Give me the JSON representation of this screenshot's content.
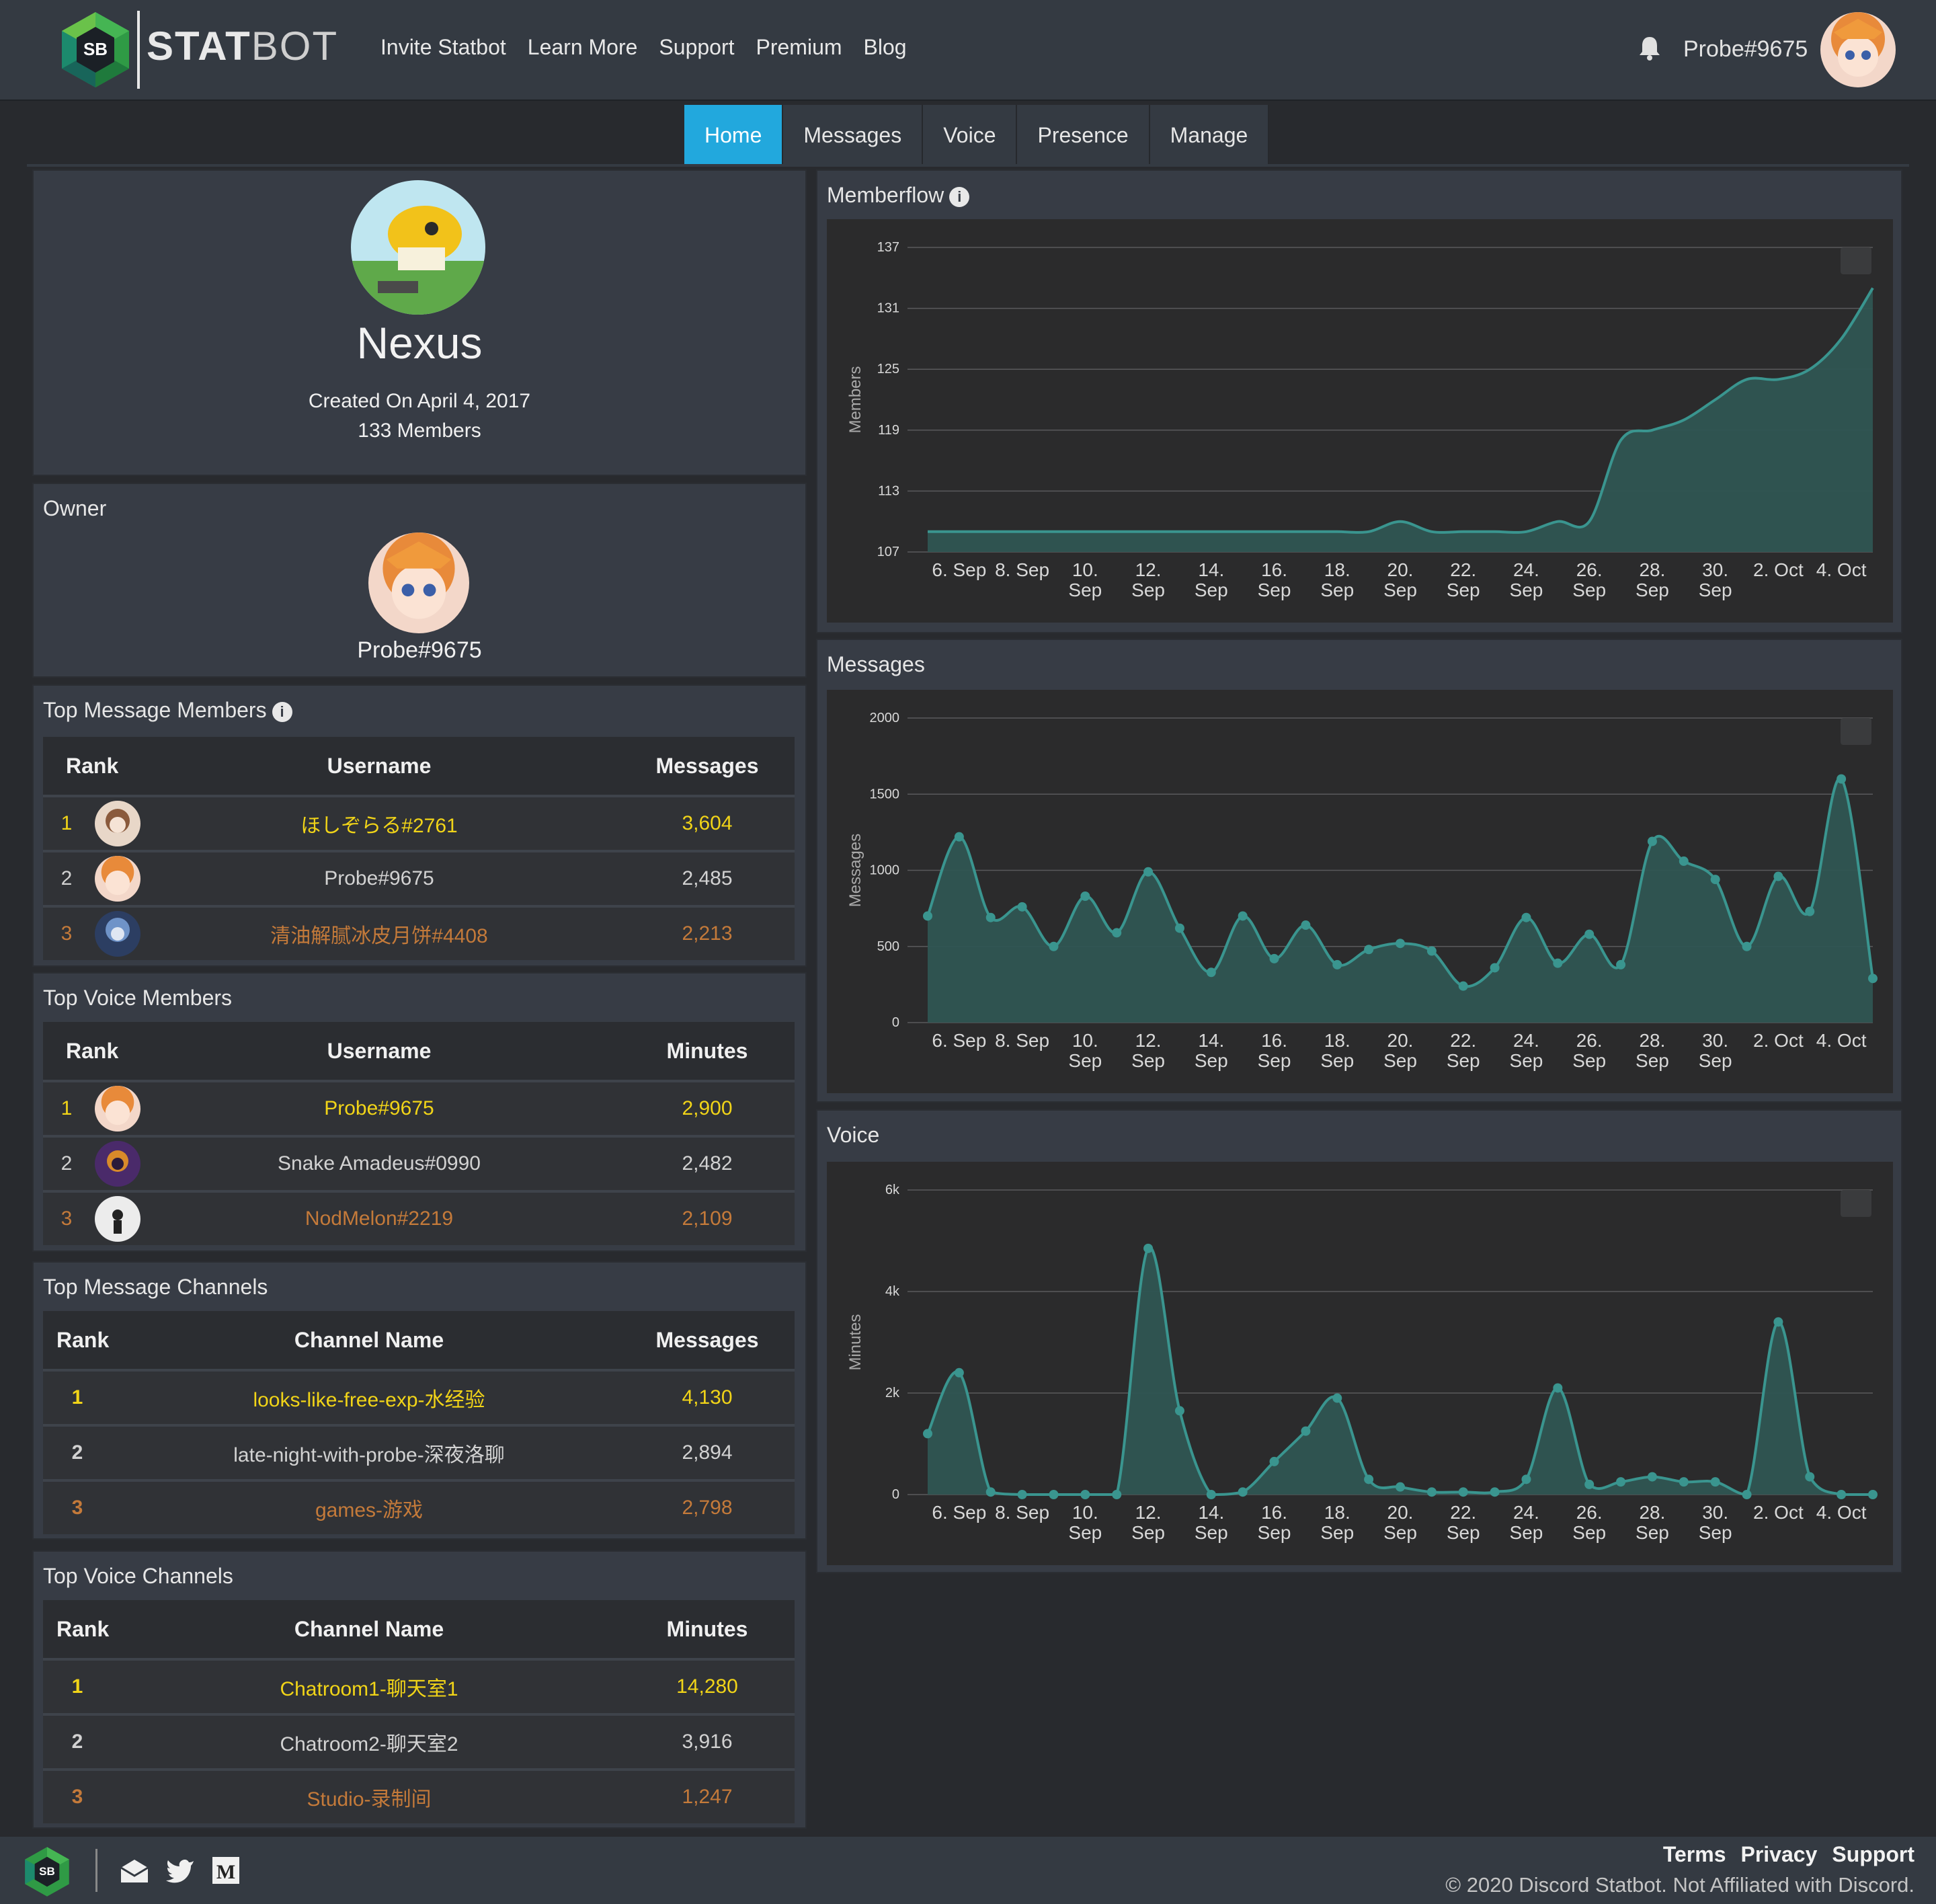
{
  "brand": {
    "badge": "SB",
    "name_bold": "STAT",
    "name_thin": "BOT"
  },
  "nav": {
    "links": [
      "Invite Statbot",
      "Learn More",
      "Support",
      "Premium",
      "Blog"
    ]
  },
  "user": {
    "name": "Probe#9675",
    "icon": "bell-icon"
  },
  "tabs": [
    "Home",
    "Messages",
    "Voice",
    "Presence",
    "Manage"
  ],
  "server": {
    "name": "Nexus",
    "created": "Created On April 4, 2017",
    "members": "133 Members"
  },
  "owner": {
    "title": "Owner",
    "name": "Probe#9675"
  },
  "top_message_members": {
    "title": "Top Message Members",
    "headers": [
      "Rank",
      "Username",
      "Messages"
    ],
    "rows": [
      {
        "rank": "1",
        "name": "ほしぞらる#2761",
        "value": "3,604"
      },
      {
        "rank": "2",
        "name": "Probe#9675",
        "value": "2,485"
      },
      {
        "rank": "3",
        "name": "清油解腻冰皮月饼#4408",
        "value": "2,213"
      }
    ]
  },
  "top_voice_members": {
    "title": "Top Voice Members",
    "headers": [
      "Rank",
      "Username",
      "Minutes"
    ],
    "rows": [
      {
        "rank": "1",
        "name": "Probe#9675",
        "value": "2,900"
      },
      {
        "rank": "2",
        "name": "Snake Amadeus#0990",
        "value": "2,482"
      },
      {
        "rank": "3",
        "name": "NodMelon#2219",
        "value": "2,109"
      }
    ]
  },
  "top_message_channels": {
    "title": "Top Message Channels",
    "headers": [
      "Rank",
      "Channel Name",
      "Messages"
    ],
    "rows": [
      {
        "rank": "1",
        "name": "looks-like-free-exp-水经验",
        "value": "4,130"
      },
      {
        "rank": "2",
        "name": "late-night-with-probe-深夜洛聊",
        "value": "2,894"
      },
      {
        "rank": "3",
        "name": "games-游戏",
        "value": "2,798"
      }
    ]
  },
  "top_voice_channels": {
    "title": "Top Voice Channels",
    "headers": [
      "Rank",
      "Channel Name",
      "Minutes"
    ],
    "rows": [
      {
        "rank": "1",
        "name": "Chatroom1-聊天室1",
        "value": "14,280"
      },
      {
        "rank": "2",
        "name": "Chatroom2-聊天室2",
        "value": "3,916"
      },
      {
        "rank": "3",
        "name": "Studio-录制间",
        "value": "1,247"
      }
    ]
  },
  "colors": {
    "accent": "#22a8dd",
    "series": "#3a958f",
    "series_fill": "#2f5552",
    "gold": "#f1d418",
    "bronze": "#c47a3a"
  },
  "chart_data": [
    {
      "id": "memberflow",
      "type": "area",
      "title": "Memberflow",
      "ylabel": "Members",
      "ylim": [
        107,
        137
      ],
      "yticks": [
        "107",
        "113",
        "119",
        "125",
        "131",
        "137"
      ],
      "xticks": [
        "6. Sep",
        "8. Sep",
        "10. Sep",
        "12. Sep",
        "14. Sep",
        "16. Sep",
        "18. Sep",
        "20. Sep",
        "22. Sep",
        "24. Sep",
        "26. Sep",
        "28. Sep",
        "30. Sep",
        "2. Oct",
        "4. Oct"
      ],
      "x": [
        "5 Sep",
        "6 Sep",
        "7 Sep",
        "8 Sep",
        "9 Sep",
        "10 Sep",
        "11 Sep",
        "12 Sep",
        "13 Sep",
        "14 Sep",
        "15 Sep",
        "16 Sep",
        "17 Sep",
        "18 Sep",
        "19 Sep",
        "20 Sep",
        "21 Sep",
        "22 Sep",
        "23 Sep",
        "24 Sep",
        "25 Sep",
        "26 Sep",
        "27 Sep",
        "28 Sep",
        "29 Sep",
        "30 Sep",
        "1 Oct",
        "2 Oct",
        "3 Oct",
        "4 Oct",
        "5 Oct"
      ],
      "values": [
        109,
        109,
        109,
        109,
        109,
        109,
        109,
        109,
        109,
        109,
        109,
        109,
        109,
        109,
        109,
        110,
        109,
        109,
        109,
        109,
        110,
        110,
        118,
        119,
        120,
        122,
        124,
        124,
        125,
        128,
        133
      ],
      "grid": true
    },
    {
      "id": "messages",
      "type": "area",
      "title": "Messages",
      "ylabel": "Messages",
      "ylim": [
        0,
        2000
      ],
      "yticks": [
        "0",
        "500",
        "1000",
        "1500",
        "2000"
      ],
      "xticks": [
        "6. Sep",
        "8. Sep",
        "10. Sep",
        "12. Sep",
        "14. Sep",
        "16. Sep",
        "18. Sep",
        "20. Sep",
        "22. Sep",
        "24. Sep",
        "26. Sep",
        "28. Sep",
        "30. Sep",
        "2. Oct",
        "4. Oct"
      ],
      "x": [
        "5 Sep",
        "6 Sep",
        "7 Sep",
        "8 Sep",
        "9 Sep",
        "10 Sep",
        "11 Sep",
        "12 Sep",
        "13 Sep",
        "14 Sep",
        "15 Sep",
        "16 Sep",
        "17 Sep",
        "18 Sep",
        "19 Sep",
        "20 Sep",
        "21 Sep",
        "22 Sep",
        "23 Sep",
        "24 Sep",
        "25 Sep",
        "26 Sep",
        "27 Sep",
        "28 Sep",
        "29 Sep",
        "30 Sep",
        "1 Oct",
        "2 Oct",
        "3 Oct",
        "4 Oct",
        "5 Oct"
      ],
      "values": [
        700,
        1220,
        690,
        760,
        500,
        830,
        590,
        990,
        620,
        330,
        700,
        420,
        640,
        380,
        480,
        520,
        470,
        240,
        360,
        690,
        390,
        580,
        380,
        1190,
        1060,
        940,
        500,
        960,
        730,
        1600,
        290
      ],
      "grid": true
    },
    {
      "id": "voice",
      "type": "area",
      "title": "Voice",
      "ylabel": "Minutes",
      "ylim": [
        0,
        6000
      ],
      "yticks": [
        "0",
        "2k",
        "4k",
        "6k"
      ],
      "xticks": [
        "6. Sep",
        "8. Sep",
        "10. Sep",
        "12. Sep",
        "14. Sep",
        "16. Sep",
        "18. Sep",
        "20. Sep",
        "22. Sep",
        "24. Sep",
        "26. Sep",
        "28. Sep",
        "30. Sep",
        "2. Oct",
        "4. Oct"
      ],
      "x": [
        "5 Sep",
        "6 Sep",
        "7 Sep",
        "8 Sep",
        "9 Sep",
        "10 Sep",
        "11 Sep",
        "12 Sep",
        "13 Sep",
        "14 Sep",
        "15 Sep",
        "16 Sep",
        "17 Sep",
        "18 Sep",
        "19 Sep",
        "20 Sep",
        "21 Sep",
        "22 Sep",
        "23 Sep",
        "24 Sep",
        "25 Sep",
        "26 Sep",
        "27 Sep",
        "28 Sep",
        "29 Sep",
        "30 Sep",
        "1 Oct",
        "2 Oct",
        "3 Oct",
        "4 Oct",
        "5 Oct"
      ],
      "values": [
        1200,
        2400,
        50,
        0,
        0,
        0,
        0,
        4850,
        1650,
        0,
        50,
        650,
        1250,
        1900,
        300,
        150,
        50,
        50,
        50,
        300,
        2100,
        200,
        250,
        350,
        250,
        250,
        0,
        3400,
        350,
        0,
        0
      ],
      "grid": true
    }
  ],
  "footer": {
    "links": [
      "Terms",
      "Privacy",
      "Support"
    ],
    "copyright": "© 2020 Discord Statbot. Not Affiliated with Discord.",
    "icons": [
      "mail-icon",
      "twitter-icon",
      "medium-icon"
    ]
  }
}
